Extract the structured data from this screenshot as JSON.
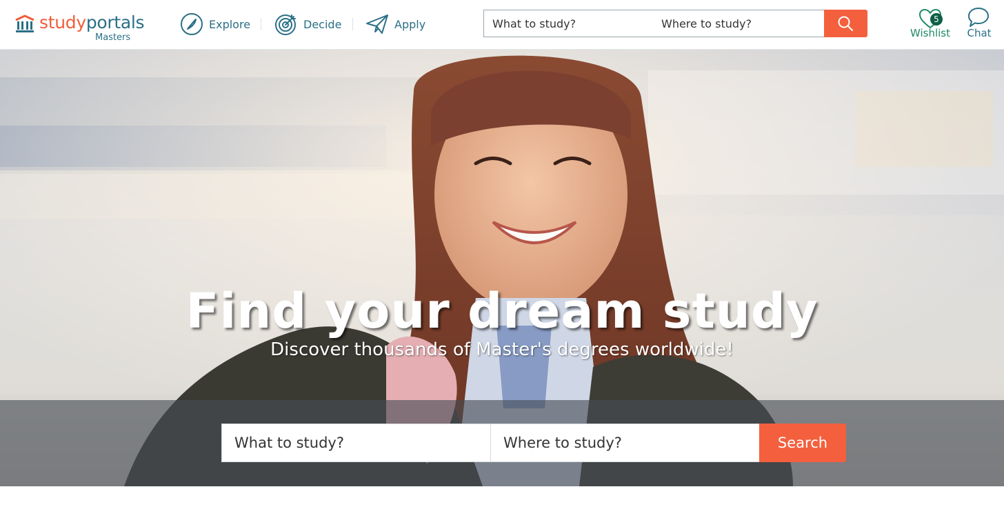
{
  "header": {
    "logo": {
      "word_part1": "study",
      "word_part2": "portals",
      "subtitle": "Masters"
    },
    "nav": [
      {
        "label": "Explore",
        "icon": "compass-icon"
      },
      {
        "label": "Decide",
        "icon": "target-icon"
      },
      {
        "label": "Apply",
        "icon": "paper-plane-icon"
      }
    ],
    "search": {
      "what_placeholder": "What to study?",
      "where_placeholder": "Where to study?",
      "button_icon": "search-icon"
    },
    "wishlist": {
      "label": "Wishlist",
      "count": "5",
      "icon": "heart-icon"
    },
    "chat": {
      "label": "Chat",
      "icon": "chat-bubble-icon"
    }
  },
  "hero": {
    "title": "Find your dream study",
    "subtitle": "Discover thousands of Master's degrees worldwide!",
    "search": {
      "what_placeholder": "What to study?",
      "where_placeholder": "Where to study?",
      "button_label": "Search"
    }
  },
  "colors": {
    "brand_orange": "#f45f3d",
    "brand_teal": "#2a6f86",
    "wishlist_green": "#1f8a64",
    "badge_green": "#0f5f46"
  }
}
